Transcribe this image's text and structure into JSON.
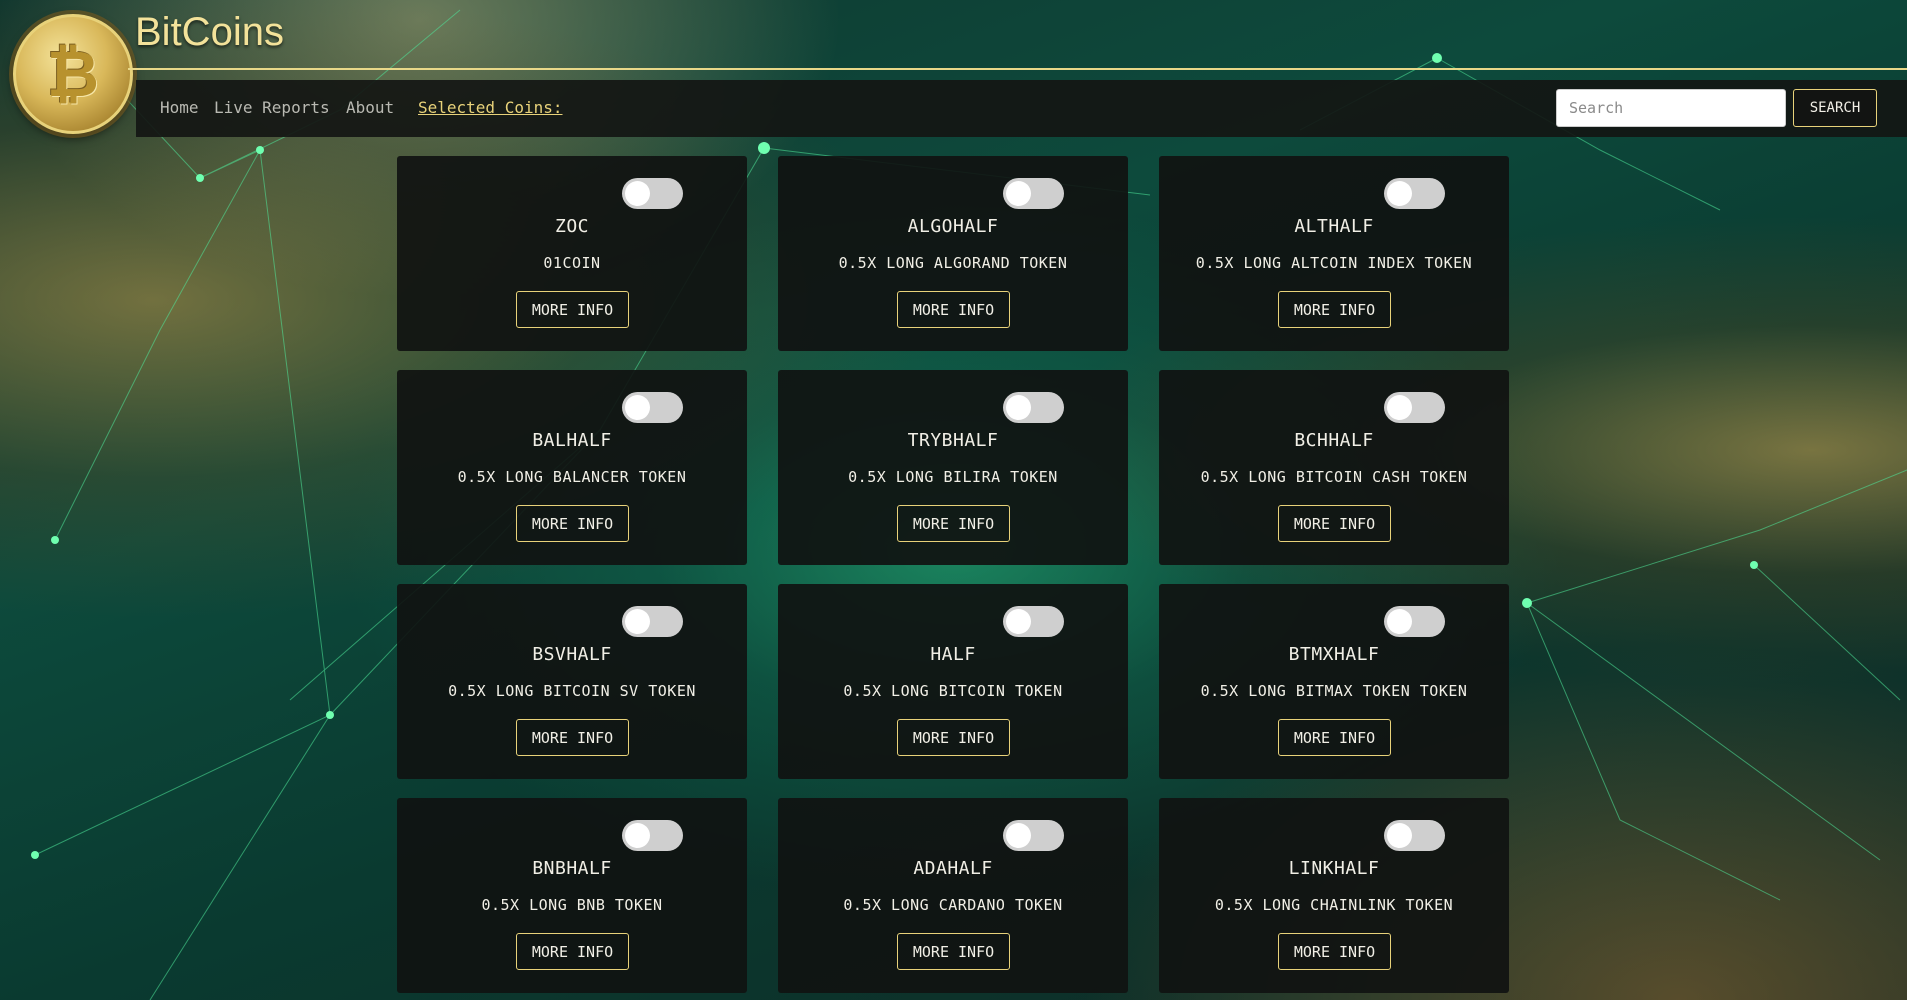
{
  "brand": {
    "title": "BitCoins",
    "logo_glyph": "₿"
  },
  "nav": {
    "items": [
      "Home",
      "Live Reports",
      "About"
    ],
    "selected_coins_label": "Selected Coins:"
  },
  "search": {
    "placeholder": "Search",
    "button_label": "SEARCH"
  },
  "cards": [
    {
      "symbol": "ZOC",
      "name": "01COIN",
      "button": "MORE INFO",
      "selected": false
    },
    {
      "symbol": "ALGOHALF",
      "name": "0.5X LONG ALGORAND TOKEN",
      "button": "MORE INFO",
      "selected": false
    },
    {
      "symbol": "ALTHALF",
      "name": "0.5X LONG ALTCOIN INDEX TOKEN",
      "button": "MORE INFO",
      "selected": false
    },
    {
      "symbol": "BALHALF",
      "name": "0.5X LONG BALANCER TOKEN",
      "button": "MORE INFO",
      "selected": false
    },
    {
      "symbol": "TRYBHALF",
      "name": "0.5X LONG BILIRA TOKEN",
      "button": "MORE INFO",
      "selected": false
    },
    {
      "symbol": "BCHHALF",
      "name": "0.5X LONG BITCOIN CASH TOKEN",
      "button": "MORE INFO",
      "selected": false
    },
    {
      "symbol": "BSVHALF",
      "name": "0.5X LONG BITCOIN SV TOKEN",
      "button": "MORE INFO",
      "selected": false
    },
    {
      "symbol": "HALF",
      "name": "0.5X LONG BITCOIN TOKEN",
      "button": "MORE INFO",
      "selected": false
    },
    {
      "symbol": "BTMXHALF",
      "name": "0.5X LONG BITMAX TOKEN TOKEN",
      "button": "MORE INFO",
      "selected": false
    },
    {
      "symbol": "BNBHALF",
      "name": "0.5X LONG BNB TOKEN",
      "button": "MORE INFO",
      "selected": false
    },
    {
      "symbol": "ADAHALF",
      "name": "0.5X LONG CARDANO TOKEN",
      "button": "MORE INFO",
      "selected": false
    },
    {
      "symbol": "LINKHALF",
      "name": "0.5X LONG CHAINLINK TOKEN",
      "button": "MORE INFO",
      "selected": false
    }
  ],
  "colors": {
    "accent": "#e8d27a",
    "card_bg": "#101211",
    "text": "#f1efe6",
    "toggle_off": "#cfcfcf"
  }
}
